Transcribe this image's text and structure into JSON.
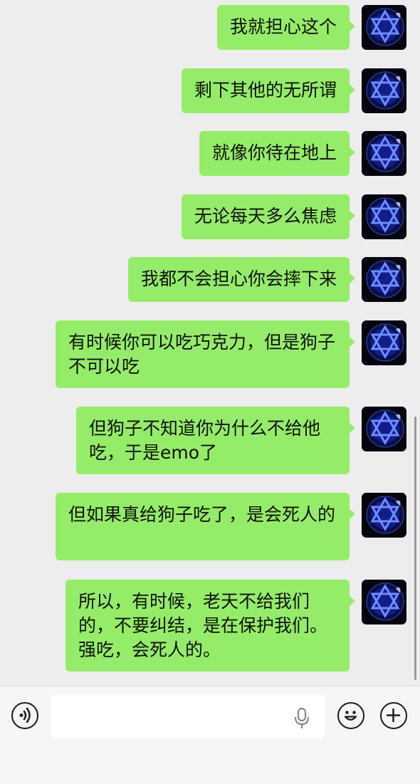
{
  "messages": [
    {
      "text": "我就担心这个"
    },
    {
      "text": "剩下其他的无所谓"
    },
    {
      "text": "就像你待在地上"
    },
    {
      "text": "无论每天多么焦虑"
    },
    {
      "text": "我都不会担心你会摔下来"
    },
    {
      "text": "有时候你可以吃巧克力，但是狗子不可以吃"
    },
    {
      "text": "但狗子不知道你为什么不给他吃，于是emo了"
    },
    {
      "text": "但如果真给狗子吃了，是会死人的"
    },
    {
      "text": "所以，有时候，老天不给我们的，不要纠结，是在保护我们。强吃，会死人的。"
    }
  ],
  "avatar": {
    "icon": "hexagram-avatar-icon",
    "colors": {
      "background": "#050510",
      "glow": "#1f3cff",
      "star": "#6f8cff"
    }
  },
  "input_bar": {
    "voice_icon": "voice-icon",
    "mic_icon": "microphone-icon",
    "emoji_icon": "emoji-icon",
    "plus_icon": "plus-icon",
    "input_value": ""
  },
  "theme": {
    "bubble_color": "#95ec69",
    "chat_background": "#ededed",
    "input_bar_background": "#f6f6f6"
  }
}
